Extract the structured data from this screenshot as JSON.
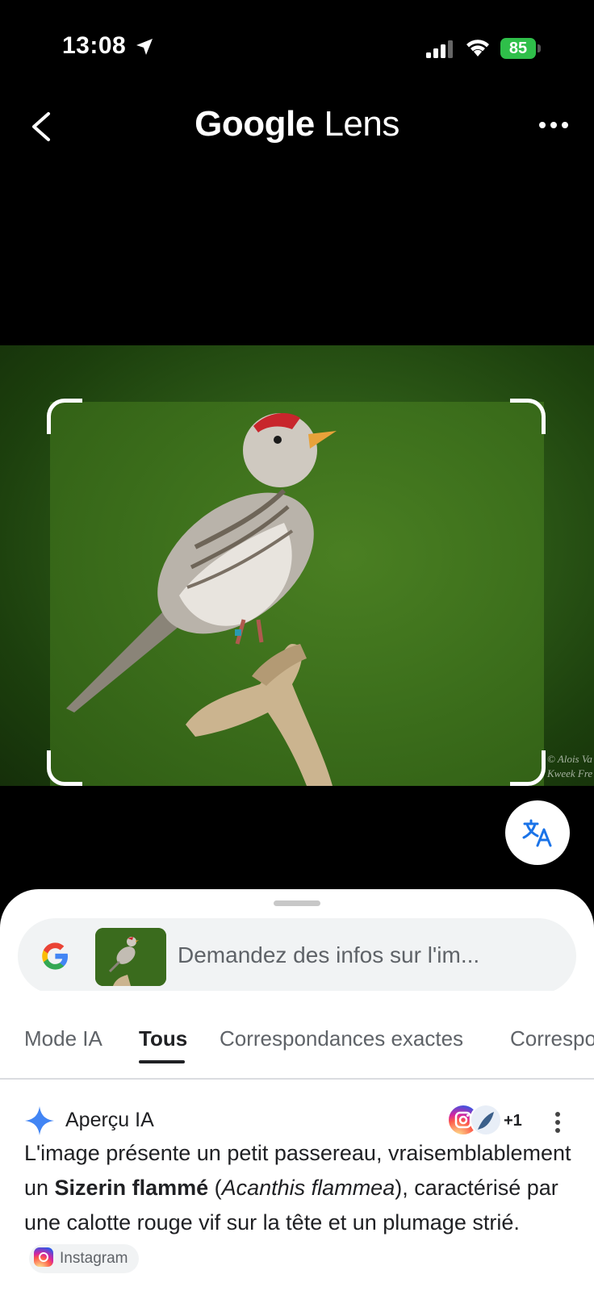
{
  "status_bar": {
    "time": "13:08",
    "battery": "85"
  },
  "header": {
    "title_brand": "Google",
    "title_rest": "Lens"
  },
  "photo": {
    "watermark_line1": "© Alois Va",
    "watermark_line2": "Kweek Fre"
  },
  "search": {
    "placeholder": "Demandez des infos sur l'im..."
  },
  "tabs": [
    {
      "label": "Mode IA"
    },
    {
      "label": "Tous"
    },
    {
      "label": "Correspondances exactes"
    },
    {
      "label": "Correspo"
    }
  ],
  "ai_overview": {
    "title": "Aperçu IA",
    "source_count": "+1",
    "text_part1": "L'image présente un petit passereau, vraisemblablement un ",
    "text_bold": "Sizerin flammé",
    "text_part2": " (",
    "text_italic": "Acanthis flammea",
    "text_part3": "), caractérisé par une calotte rouge vif sur la tête et un plumage strié.",
    "chip_label": "Instagram"
  },
  "colors": {
    "accent_blue": "#4285F4",
    "battery_green": "#2fbf4a"
  }
}
